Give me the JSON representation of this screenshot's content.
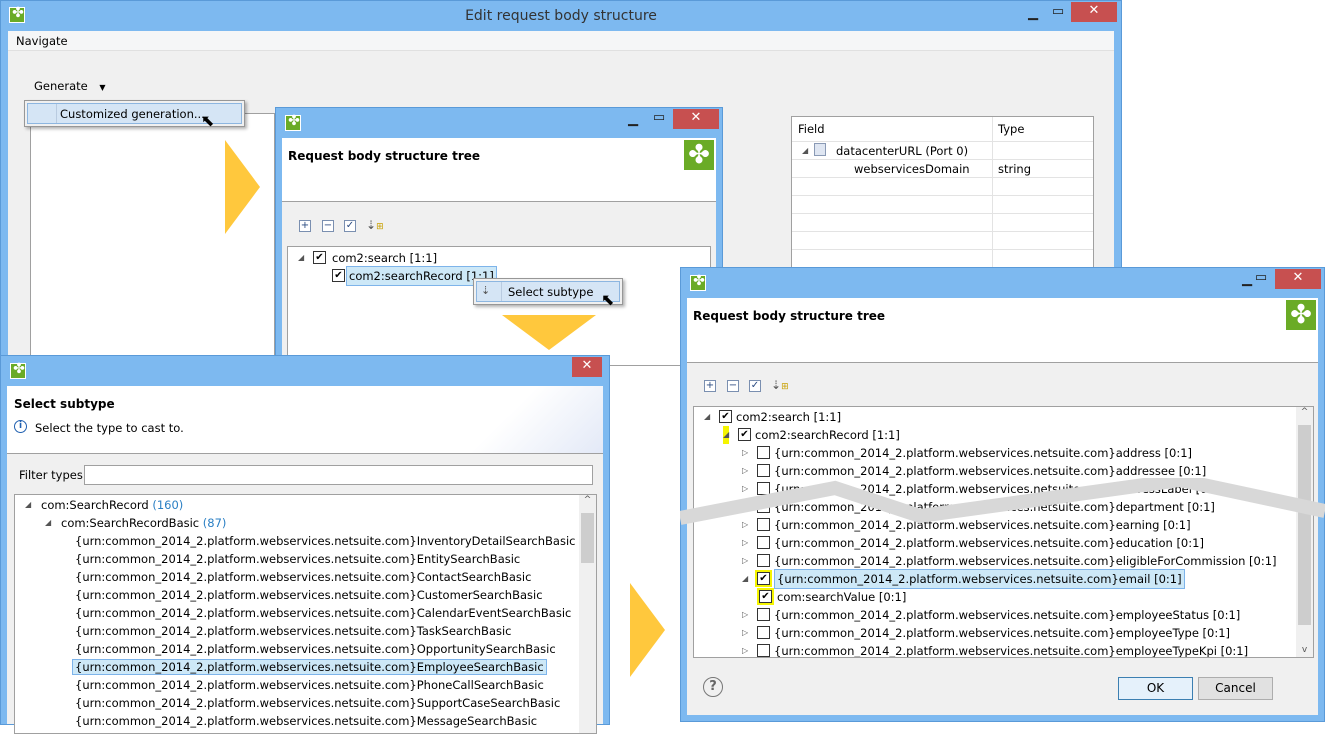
{
  "main_window": {
    "title": "Edit request body structure",
    "menu": [
      "Navigate"
    ],
    "generate_label": "Generate",
    "dropdown_item": "Customized generation...",
    "table": {
      "columns": [
        "Field",
        "Type"
      ],
      "rows": [
        {
          "field": "datacenterURL (Port 0)",
          "type": "",
          "level": 0
        },
        {
          "field": "webservicesDomain",
          "type": "string",
          "level": 1
        }
      ]
    }
  },
  "tree_dialog_small": {
    "header_title": "Request body structure tree",
    "nodes": [
      {
        "label": "com2:search [1:1]",
        "checked": true
      },
      {
        "label": "com2:searchRecord [1:1]",
        "checked": true,
        "selected": true
      }
    ],
    "context_menu_item": "Select subtype"
  },
  "subtype_dialog": {
    "header_title": "Select subtype",
    "info": "Select the type to cast to.",
    "filter_label": "Filter types:",
    "filter_value": "",
    "root": {
      "label": "com:SearchRecord",
      "count": "(160)"
    },
    "child": {
      "label": "com:SearchRecordBasic",
      "count": "(87)"
    },
    "items": [
      "{urn:common_2014_2.platform.webservices.netsuite.com}InventoryDetailSearchBasic",
      "{urn:common_2014_2.platform.webservices.netsuite.com}EntitySearchBasic",
      "{urn:common_2014_2.platform.webservices.netsuite.com}ContactSearchBasic",
      "{urn:common_2014_2.platform.webservices.netsuite.com}CustomerSearchBasic",
      "{urn:common_2014_2.platform.webservices.netsuite.com}CalendarEventSearchBasic",
      "{urn:common_2014_2.platform.webservices.netsuite.com}TaskSearchBasic",
      "{urn:common_2014_2.platform.webservices.netsuite.com}OpportunitySearchBasic",
      "{urn:common_2014_2.platform.webservices.netsuite.com}EmployeeSearchBasic",
      "{urn:common_2014_2.platform.webservices.netsuite.com}PhoneCallSearchBasic",
      "{urn:common_2014_2.platform.webservices.netsuite.com}SupportCaseSearchBasic",
      "{urn:common_2014_2.platform.webservices.netsuite.com}MessageSearchBasic"
    ],
    "selected_index": 7
  },
  "tree_dialog_large": {
    "header_title": "Request body structure tree",
    "nodes": [
      {
        "label": "com2:search [1:1]",
        "checked": true,
        "level": 0,
        "twisty": "open"
      },
      {
        "label": "com2:searchRecord [1:1]",
        "checked": true,
        "level": 1,
        "twisty": "open",
        "highlight": true
      },
      {
        "label": "{urn:common_2014_2.platform.webservices.netsuite.com}address [0:1]",
        "checked": false,
        "level": 2,
        "twisty": "closed"
      },
      {
        "label": "{urn:common_2014_2.platform.webservices.netsuite.com}addressee [0:1]",
        "checked": false,
        "level": 2,
        "twisty": "closed"
      },
      {
        "label": "{urn:common_2014_2.platform.webservices.netsuite.com}addressLabel [0:1]",
        "checked": false,
        "level": 2,
        "twisty": "closed"
      },
      {
        "label": "{urn:common_2014_2.platform.webservices.netsuite.com}department [0:1]",
        "checked": false,
        "level": 2,
        "twisty": "closed"
      },
      {
        "label": "{urn:common_2014_2.platform.webservices.netsuite.com}earning [0:1]",
        "checked": false,
        "level": 2,
        "twisty": "closed"
      },
      {
        "label": "{urn:common_2014_2.platform.webservices.netsuite.com}education [0:1]",
        "checked": false,
        "level": 2,
        "twisty": "closed"
      },
      {
        "label": "{urn:common_2014_2.platform.webservices.netsuite.com}eligibleForCommission [0:1]",
        "checked": false,
        "level": 2,
        "twisty": "closed"
      },
      {
        "label": "{urn:common_2014_2.platform.webservices.netsuite.com}email [0:1]",
        "checked": true,
        "level": 2,
        "twisty": "open",
        "highlight": true,
        "selected": true
      },
      {
        "label": "com:searchValue [0:1]",
        "checked": true,
        "level": 3,
        "twisty": "none",
        "highlight": true
      },
      {
        "label": "{urn:common_2014_2.platform.webservices.netsuite.com}employeeStatus [0:1]",
        "checked": false,
        "level": 2,
        "twisty": "closed"
      },
      {
        "label": "{urn:common_2014_2.platform.webservices.netsuite.com}employeeType [0:1]",
        "checked": false,
        "level": 2,
        "twisty": "closed"
      },
      {
        "label": "{urn:common_2014_2.platform.webservices.netsuite.com}employeeTypeKpi [0:1]",
        "checked": false,
        "level": 2,
        "twisty": "closed"
      }
    ],
    "ok_label": "OK",
    "cancel_label": "Cancel"
  },
  "colors": {
    "titlebar": "#7db9f0",
    "close": "#c75050",
    "arrow": "#ffc83d",
    "highlight": "#f5f500",
    "brand": "#6aab26"
  }
}
